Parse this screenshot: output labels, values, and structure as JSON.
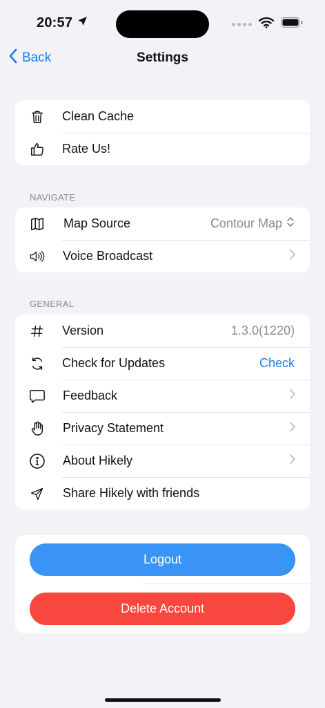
{
  "status_bar": {
    "time": "20:57"
  },
  "nav": {
    "back_label": "Back",
    "title": "Settings"
  },
  "group_top": {
    "items": [
      {
        "label": "Clean Cache",
        "icon": "trash-icon"
      },
      {
        "label": "Rate Us!",
        "icon": "thumbs-up-icon"
      }
    ]
  },
  "navigate": {
    "header": "NAVIGATE",
    "items": [
      {
        "label": "Map Source",
        "value": "Contour Map",
        "icon": "map-icon"
      },
      {
        "label": "Voice Broadcast",
        "icon": "speaker-icon"
      }
    ]
  },
  "general": {
    "header": "GENERAL",
    "items": [
      {
        "label": "Version",
        "value": "1.3.0(1220)",
        "icon": "hash-icon"
      },
      {
        "label": "Check for Updates",
        "value": "Check",
        "icon": "refresh-icon"
      },
      {
        "label": "Feedback",
        "icon": "chat-bubble-icon"
      },
      {
        "label": "Privacy Statement",
        "icon": "hand-icon"
      },
      {
        "label": "About Hikely",
        "icon": "info-icon"
      },
      {
        "label": "Share Hikely with friends",
        "icon": "send-icon"
      }
    ]
  },
  "account": {
    "logout_label": "Logout",
    "delete_label": "Delete Account"
  },
  "colors": {
    "accent": "#1a7cf2",
    "logout": "#3a94f5",
    "delete": "#f7473f",
    "background": "#f2f2f7"
  }
}
